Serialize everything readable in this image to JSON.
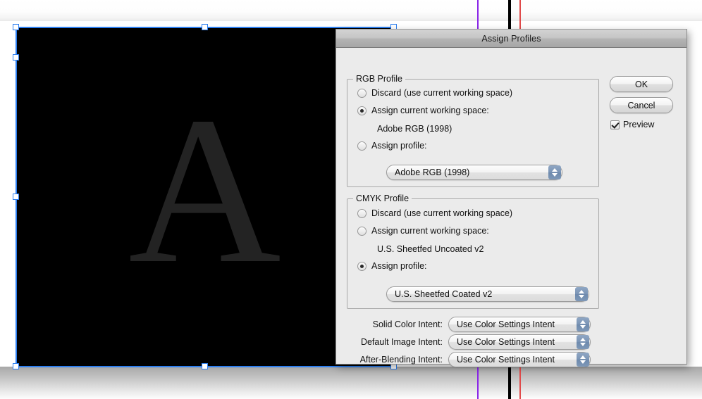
{
  "canvas": {
    "artwork_letter": "A",
    "artwork_bg_color": "#000000",
    "artwork_letter_color": "#232323",
    "selection_color": "#2d7ff0",
    "guides": [
      {
        "name": "guide-purple",
        "color": "#8a25e8"
      },
      {
        "name": "guide-black",
        "color": "#000000"
      },
      {
        "name": "guide-red",
        "color": "#e04a4a"
      }
    ]
  },
  "dialog": {
    "title": "Assign Profiles",
    "rgb_group": {
      "legend": "RGB Profile",
      "options": [
        {
          "label": "Discard (use current working space)",
          "selected": false
        },
        {
          "label": "Assign current working space:",
          "selected": true
        },
        {
          "label": "Assign profile:",
          "selected": false
        }
      ],
      "working_space_value": "Adobe RGB (1998)",
      "profile_popup_value": "Adobe RGB (1998)"
    },
    "cmyk_group": {
      "legend": "CMYK Profile",
      "options": [
        {
          "label": "Discard (use current working space)",
          "selected": false
        },
        {
          "label": "Assign current working space:",
          "selected": false
        },
        {
          "label": "Assign profile:",
          "selected": true
        }
      ],
      "working_space_value": "U.S. Sheetfed Uncoated v2",
      "profile_popup_value": "U.S. Sheetfed Coated v2"
    },
    "intents": [
      {
        "label": "Solid Color Intent:",
        "value": "Use Color Settings Intent"
      },
      {
        "label": "Default Image Intent:",
        "value": "Use Color Settings Intent"
      },
      {
        "label": "After-Blending Intent:",
        "value": "Use Color Settings Intent"
      }
    ],
    "buttons": {
      "ok": "OK",
      "cancel": "Cancel"
    },
    "preview": {
      "label": "Preview",
      "checked": true
    }
  }
}
